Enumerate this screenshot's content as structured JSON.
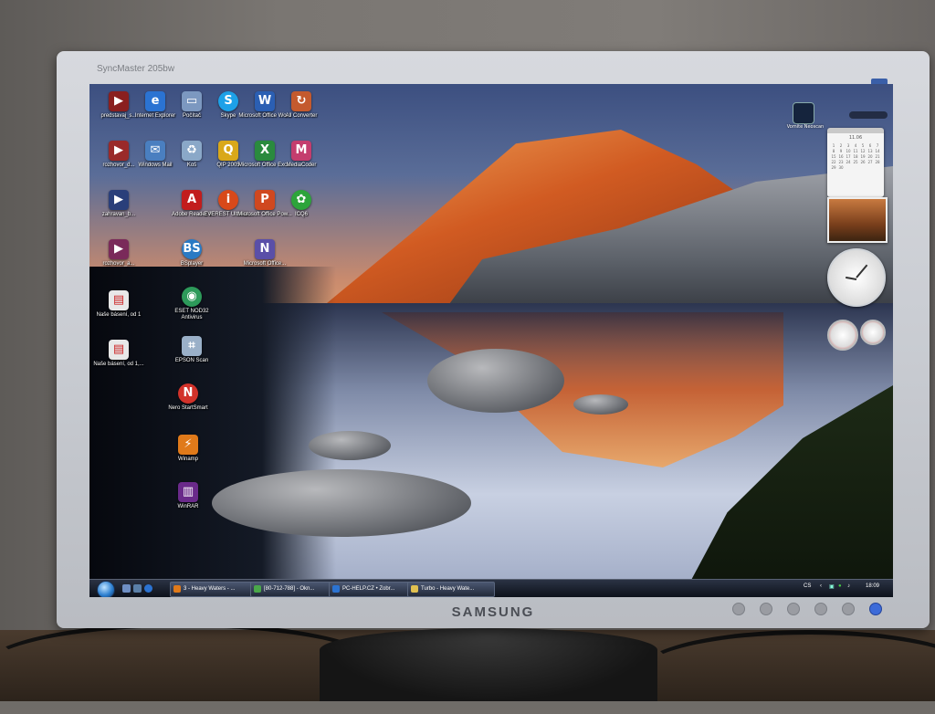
{
  "bezel": {
    "model": "SyncMaster 205bw",
    "brand": "SAMSUNG"
  },
  "desktop": {
    "icons": [
      {
        "name": "predstava-icon",
        "label": "predstavaj_s..."
      },
      {
        "name": "internet-explorer-icon",
        "label": "Internet Explorer"
      },
      {
        "name": "pocitac-icon",
        "label": "Počítač"
      },
      {
        "name": "skype-icon",
        "label": "Skype"
      },
      {
        "name": "microsoft-office-word-icon",
        "label": "Microsoft Office Wo..."
      },
      {
        "name": "all-converter-icon",
        "label": "All Converter"
      },
      {
        "name": "rozhovor-icon",
        "label": "rozhovor_d..."
      },
      {
        "name": "windows-mail-icon",
        "label": "Windows Mail"
      },
      {
        "name": "kos-icon",
        "label": "Koš"
      },
      {
        "name": "qip-2005-icon",
        "label": "QIP 2005"
      },
      {
        "name": "microsoft-office-excel-icon",
        "label": "Microsoft Office Exc..."
      },
      {
        "name": "mediacoder-icon",
        "label": "MediaCoder"
      },
      {
        "name": "zahravan-icon",
        "label": "zahravan_b..."
      },
      {
        "name": "adobe-reader-icon",
        "label": "Adobe Reader 8"
      },
      {
        "name": "everest-icon",
        "label": "EVEREST Ultimat..."
      },
      {
        "name": "microsoft-office-powerpoint-icon",
        "label": "Microsoft Office Pow..."
      },
      {
        "name": "icq-icon",
        "label": "ICQ6"
      },
      {
        "name": "rozhovor2-icon",
        "label": "rozhovor_a..."
      },
      {
        "name": "bsplayer-icon",
        "label": "BSplayer"
      },
      {
        "name": "microsoft-office-icon",
        "label": "Microsoft Office..."
      },
      {
        "name": "nase-baseni-icon",
        "label": "Naše básení, od 1"
      },
      {
        "name": "eset-nod32-icon",
        "label": "ESET NOD32 Antivirus"
      },
      {
        "name": "nase-baseni2-icon",
        "label": "Naše básení, od 1,..."
      },
      {
        "name": "epson-scan-icon",
        "label": "EPSON Scan"
      },
      {
        "name": "nero-startsmart-icon",
        "label": "Nero StartSmart"
      },
      {
        "name": "winamp-icon",
        "label": "Winamp"
      },
      {
        "name": "winrar-icon",
        "label": "WinRAR"
      }
    ]
  },
  "gadgets": {
    "weather_label": "Vomite Neoscan",
    "calendar_head": "11.06",
    "calendar_days": [
      "1",
      "2",
      "3",
      "4",
      "5",
      "6",
      "7",
      "8",
      "9",
      "10",
      "11",
      "12",
      "13",
      "14",
      "15",
      "16",
      "17",
      "18",
      "19",
      "20",
      "21",
      "22",
      "23",
      "24",
      "25",
      "26",
      "27",
      "28",
      "29",
      "30"
    ]
  },
  "taskbar": {
    "tasks": [
      {
        "label": "3 - Heavy Waters - ..."
      },
      {
        "label": "[80-712-788] - Okn..."
      },
      {
        "label": "PC-HELP.CZ • Zobr..."
      },
      {
        "label": "Turbo - Heavy Wate..."
      }
    ],
    "lang": "CS",
    "clock": "18:09"
  },
  "colors": {
    "taskbar": "#0b0f18",
    "start_orb": "#2c7fd0",
    "power_led": "#3d6bd8"
  }
}
